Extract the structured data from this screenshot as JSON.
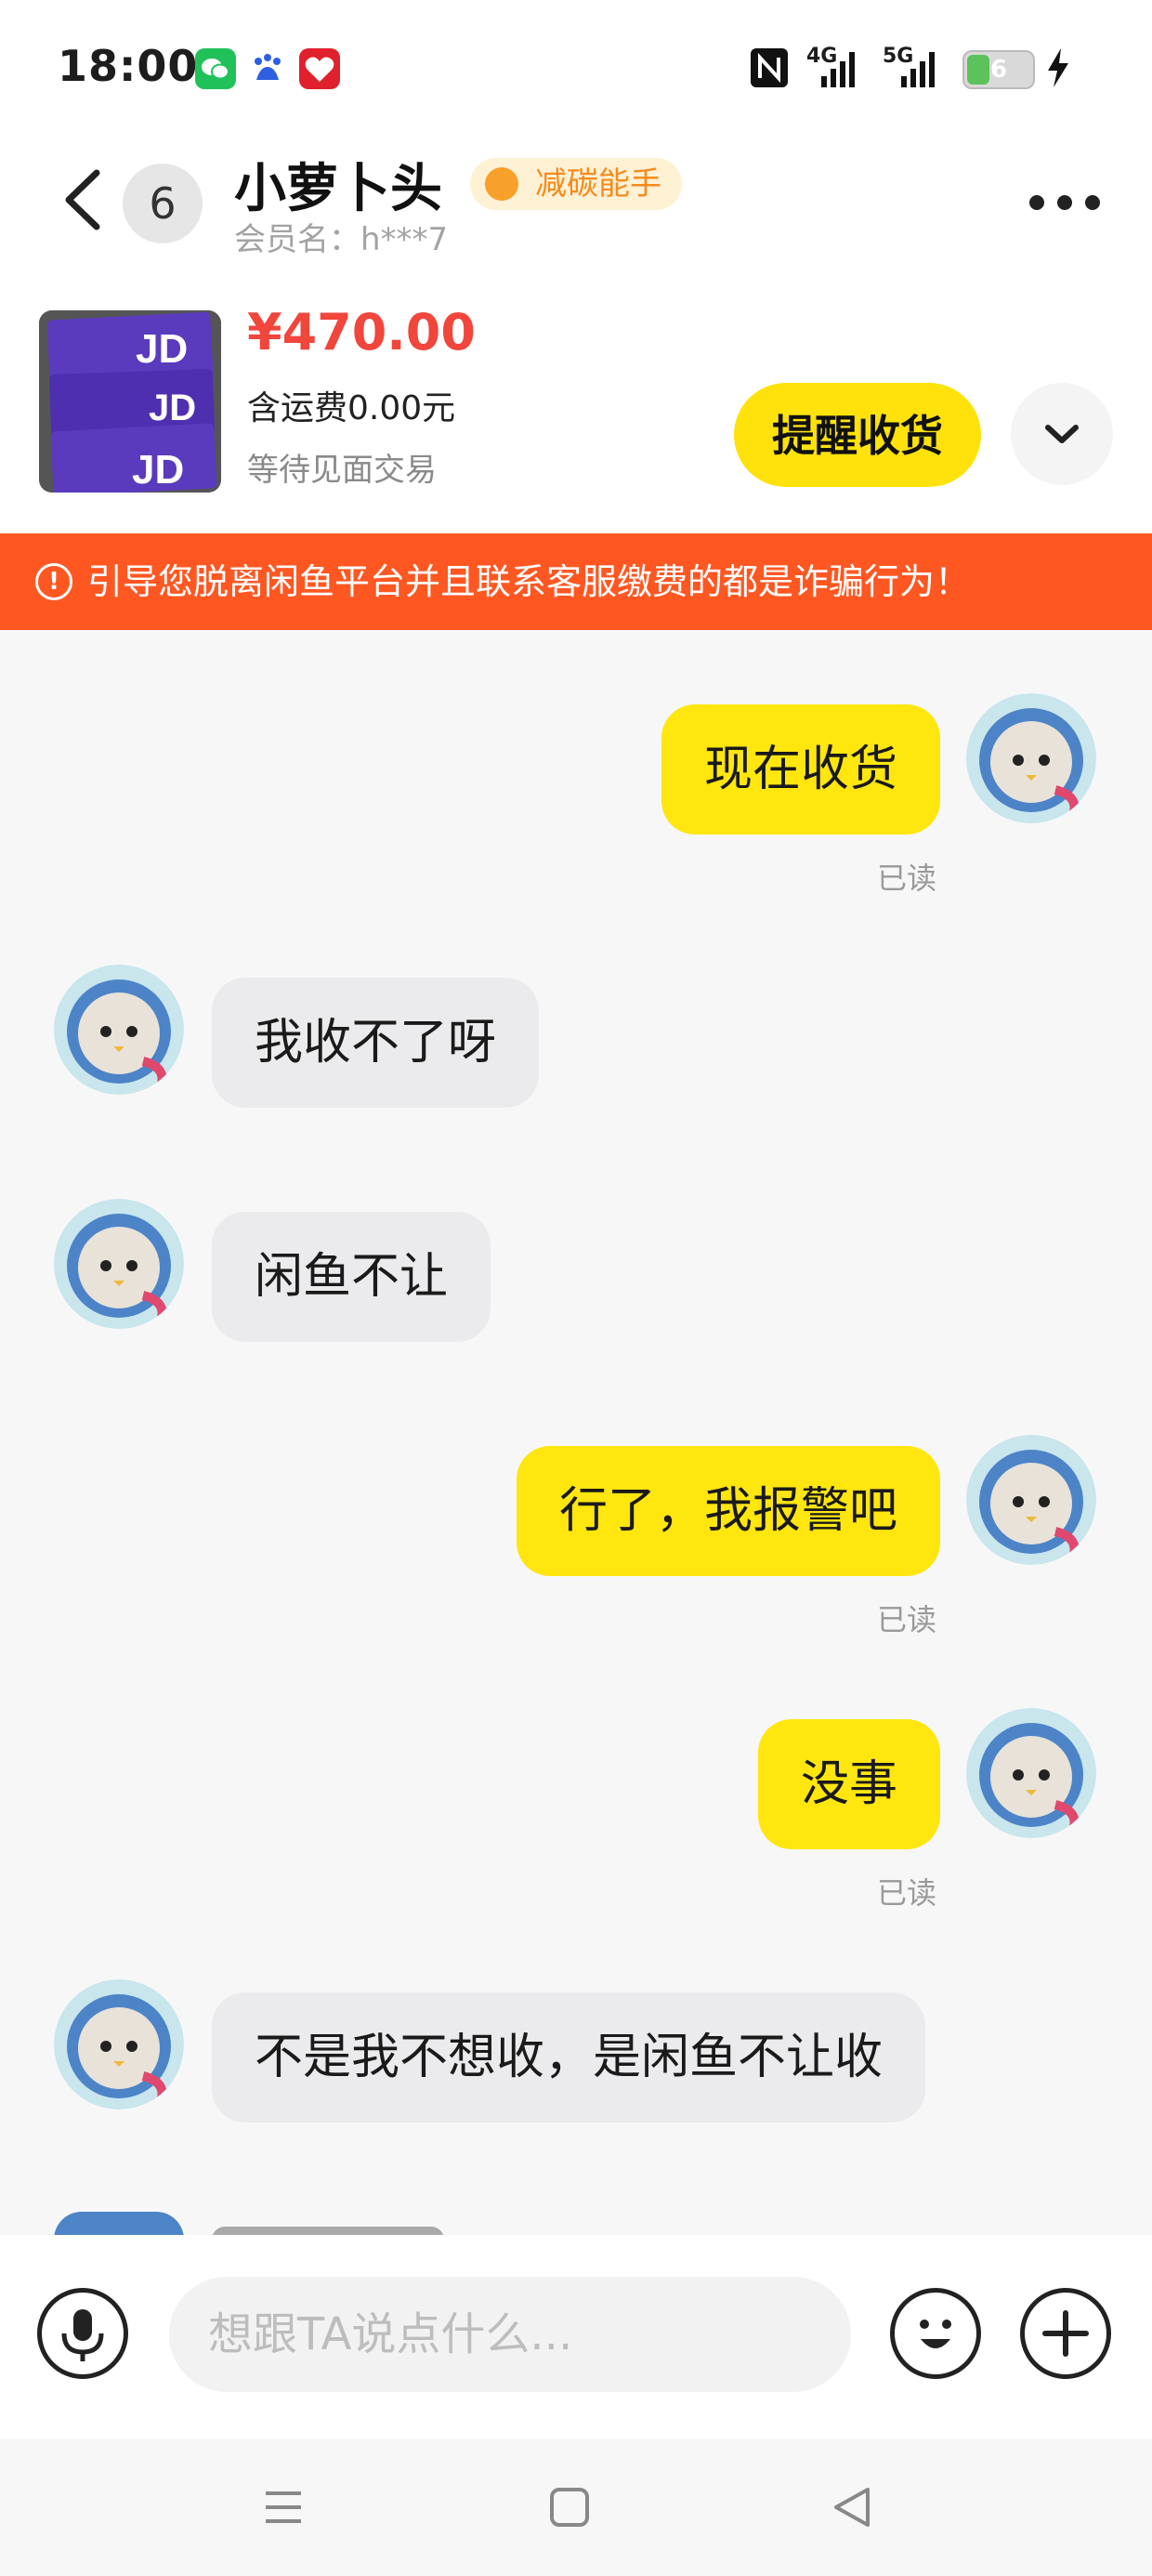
{
  "status_bar": {
    "time": "18:00",
    "network_1": "4G",
    "network_2": "5G",
    "battery": "6"
  },
  "header": {
    "unread_count": "6",
    "contact_name": "小萝卜头",
    "badge": "减碳能手",
    "member_name": "会员名：h***7"
  },
  "product": {
    "price": "¥470.00",
    "shipping": "含运费0.00元",
    "status": "等待见面交易",
    "remind_button": "提醒收货"
  },
  "warning": {
    "text": "引导您脱离闲鱼平台并且联系客服缴费的都是诈骗行为！"
  },
  "messages": [
    {
      "side": "me",
      "text": "现在收货",
      "read": "已读"
    },
    {
      "side": "them",
      "text": "我收不了呀"
    },
    {
      "side": "them",
      "text": "闲鱼不让"
    },
    {
      "side": "me",
      "text": "行了，我报警吧",
      "read": "已读"
    },
    {
      "side": "me",
      "text": "没事",
      "read": "已读"
    },
    {
      "side": "them",
      "text": "不是我不想收，是闲鱼不让收"
    }
  ],
  "input": {
    "placeholder": "想跟TA说点什么..."
  },
  "colors": {
    "accent_yellow": "#ffe60f",
    "warning_orange": "#ff5722",
    "price_red": "#f0463c"
  },
  "icons": [
    "back-arrow-icon",
    "more-icon",
    "chevron-down-icon",
    "alert-icon",
    "mic-icon",
    "emoji-icon",
    "plus-icon",
    "nav-menu-icon",
    "nav-home-icon",
    "nav-back-icon"
  ]
}
